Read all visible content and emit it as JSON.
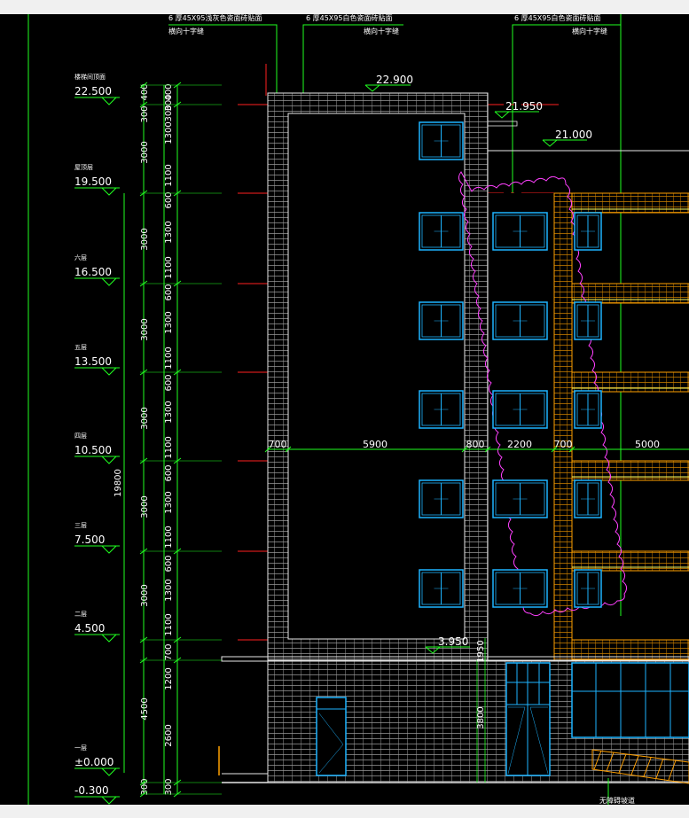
{
  "window": {
    "background": "#000000",
    "chrome_color": "#f0f0f0"
  },
  "top_notes": [
    {
      "line1": "6 厚45X95浅灰色瓷面砖贴面",
      "line2": "横向十字缝"
    },
    {
      "line1": "6 厚45X95白色瓷面砖贴面",
      "line2": "横向十字缝"
    },
    {
      "line1": "6 厚45X95白色瓷面砖贴面",
      "line2": "横向十字缝"
    }
  ],
  "levels": [
    {
      "name": "楼梯间顶面",
      "value": "22.500"
    },
    {
      "name": "屋顶层",
      "value": "19.500"
    },
    {
      "name": "六层",
      "value": "16.500"
    },
    {
      "name": "五层",
      "value": "13.500"
    },
    {
      "name": "四层",
      "value": "10.500"
    },
    {
      "name": "三层",
      "value": "7.500"
    },
    {
      "name": "二层",
      "value": "4.500"
    },
    {
      "name": "一层",
      "value": "±0.000"
    },
    {
      "name": "",
      "value": "-0.300"
    }
  ],
  "elevation_marks": {
    "top": "22.900",
    "parapet": "21.950",
    "roof": "21.000",
    "canopy": "3.950"
  },
  "vertical_dims": {
    "total": "19800",
    "upper": [
      "400",
      "300",
      "3000",
      "3000",
      "3000",
      "3000",
      "3000",
      "3000",
      "4500",
      "300"
    ],
    "lower": [
      "400",
      "300",
      "300",
      "1300",
      "1100",
      "600",
      "1300",
      "1100",
      "600",
      "1300",
      "1100",
      "600",
      "1300",
      "1100",
      "600",
      "1300",
      "1100",
      "600",
      "1300",
      "1100",
      "700",
      "1200",
      "2600",
      "300"
    ],
    "door": "3800",
    "canopy_side": "1950"
  },
  "horizontal_dims": [
    "700",
    "5900",
    "800",
    "2200",
    "700",
    "5000"
  ],
  "ramp_label": "无障碍坡道",
  "colors": {
    "axis": "#ff2020",
    "dim_line": "#20ff20",
    "wall_hatch": "#cfcfcf",
    "window": "#1eb4ff",
    "cloud": "#ff40ff",
    "orange": "#ffa000",
    "yellow": "#ffff60"
  }
}
